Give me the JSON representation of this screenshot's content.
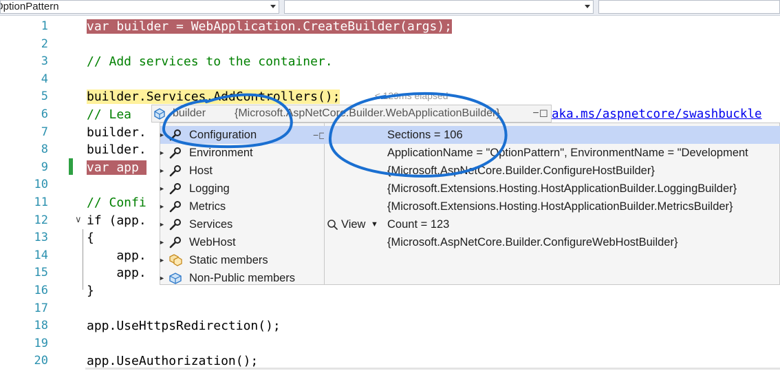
{
  "nav": {
    "project": "OptionPattern",
    "type_combo": "",
    "member_combo": ""
  },
  "editor": {
    "line_numbers": [
      "1",
      "2",
      "3",
      "4",
      "5",
      "6",
      "7",
      "8",
      "9",
      "10",
      "11",
      "12",
      "13",
      "14",
      "15",
      "16",
      "17",
      "18",
      "19",
      "20"
    ],
    "lines": [
      "var builder = WebApplication.CreateBuilder(args);",
      "",
      "// Add services to the container.",
      "",
      "builder.Services.AddControllers();",
      "// Lea",
      "builder.",
      "builder.",
      "var app ",
      "",
      "// Confi",
      "if (app.",
      "{",
      "    app.",
      "    app.",
      "}",
      "",
      "app.UseHttpsRedirection();",
      "",
      "app.UseAuthorization();"
    ],
    "line6_link": "aka.ms/aspnetcore/swashbuckle",
    "elapsed": "≤ 129ms elapsed",
    "fold_arrow": "∨"
  },
  "datatip": {
    "toggle": "▲",
    "name": "builder",
    "value": "{Microsoft.AspNetCore.Builder.WebApplicationBuilder}",
    "pin": "−◻",
    "view_label": "View",
    "view_arrow": "▼",
    "members": [
      {
        "label": "Configuration",
        "icon": "wrench-icon"
      },
      {
        "label": "Environment",
        "icon": "wrench-icon"
      },
      {
        "label": "Host",
        "icon": "wrench-icon"
      },
      {
        "label": "Logging",
        "icon": "wrench-icon"
      },
      {
        "label": "Metrics",
        "icon": "wrench-icon"
      },
      {
        "label": "Services",
        "icon": "wrench-icon"
      },
      {
        "label": "WebHost",
        "icon": "wrench-icon"
      },
      {
        "label": "Static members",
        "icon": "static-members-icon"
      },
      {
        "label": "Non-Public members",
        "icon": "object-icon"
      }
    ],
    "values": [
      "Sections = 106",
      "ApplicationName = \"OptionPattern\", EnvironmentName = \"Development",
      "{Microsoft.AspNetCore.Builder.ConfigureHostBuilder}",
      "{Microsoft.Extensions.Hosting.HostApplicationBuilder.LoggingBuilder}",
      "{Microsoft.Extensions.Hosting.HostApplicationBuilder.MetricsBuilder}",
      "Count = 123",
      "{Microsoft.AspNetCore.Builder.ConfigureWebHostBuilder}"
    ]
  },
  "colors": {
    "breakpoint_line": "#b46067",
    "current_statement": "#fff19b",
    "annotation": "#1a6fd1",
    "selection": "#c5d6f7"
  }
}
